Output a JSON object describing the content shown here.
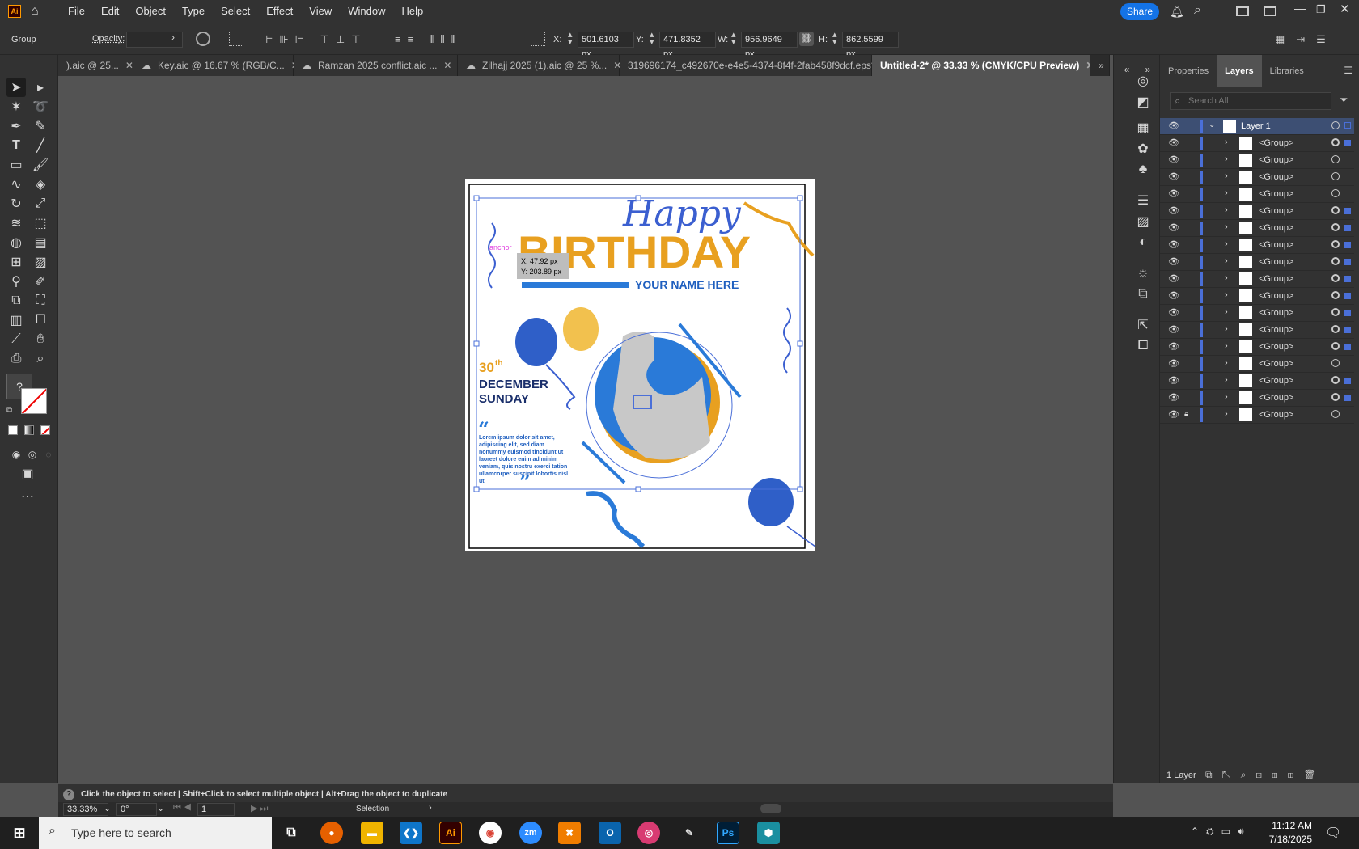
{
  "menubar": {
    "app_badge": "Ai",
    "items": [
      "File",
      "Edit",
      "Object",
      "Type",
      "Select",
      "Effect",
      "View",
      "Window",
      "Help"
    ],
    "share": "Share"
  },
  "control": {
    "selection_type": "Group",
    "opacity_label": "Opacity:",
    "x_label": "X:",
    "x_value": "501.6103 px",
    "y_label": "Y:",
    "y_value": "471.8352 px",
    "w_label": "W:",
    "w_value": "956.9649 px",
    "h_label": "H:",
    "h_value": "862.5599 px"
  },
  "tabs": [
    {
      "label": ").aic @ 25...",
      "active": false
    },
    {
      "label": "Key.aic @ 16.67 % (RGB/C...",
      "active": false
    },
    {
      "label": "Ramzan 2025 conflict.aic ...",
      "active": false
    },
    {
      "label": "Zilhajj 2025 (1).aic @ 25 %...",
      "active": false
    },
    {
      "label": "319696174_c492670e-e4e5-4374-8f4f-2fab458f9dcf.eps*",
      "active": false
    },
    {
      "label": "Untitled-2* @ 33.33 % (CMYK/CPU Preview)",
      "active": true
    }
  ],
  "artwork": {
    "happy": "Happy",
    "birthday": "BIRTHDAY",
    "your_name": "YOUR NAME HERE",
    "date_day": "30",
    "date_suffix": "th",
    "month": "DECEMBER",
    "weekday": "SUNDAY",
    "lorem": "Lorem ipsum dolor sit amet, adipiscing elit, sed diam nonummy euismod tincidunt ut laoreet dolore enim ad minim veniam, quis nostru exerci tation ullamcorper suscipit lobortis nisl ut",
    "anchor_label": "anchor",
    "cursor_x": "X: 47.92 px",
    "cursor_y": "Y: 203.89 px",
    "colors": {
      "blue": "#1f5fbf",
      "orange": "#e8a020",
      "navy": "#1a2f6b",
      "selection": "#4a6fd8"
    }
  },
  "panel": {
    "tabs": [
      "Properties",
      "Layers",
      "Libraries"
    ],
    "active_tab": "Layers",
    "search_placeholder": "Search All",
    "layer_name": "Layer 1",
    "groups": [
      "<Group>",
      "<Group>",
      "<Group>",
      "<Group>",
      "<Group>",
      "<Group>",
      "<Group>",
      "<Group>",
      "<Group>",
      "<Group>",
      "<Group>",
      "<Group>",
      "<Group>",
      "<Group>",
      "<Group>",
      "<Group>",
      "<Group>"
    ],
    "footer": "1 Layer"
  },
  "status": {
    "hint": "Click the object to select  |  Shift+Click to select multiple object  |  Alt+Drag the object to duplicate",
    "zoom": "33.33%",
    "rotation": "0°",
    "artboard_num": "1",
    "tool": "Selection"
  },
  "taskbar": {
    "search_placeholder": "Type here to search",
    "time": "11:12 AM",
    "date": "7/18/2025"
  }
}
